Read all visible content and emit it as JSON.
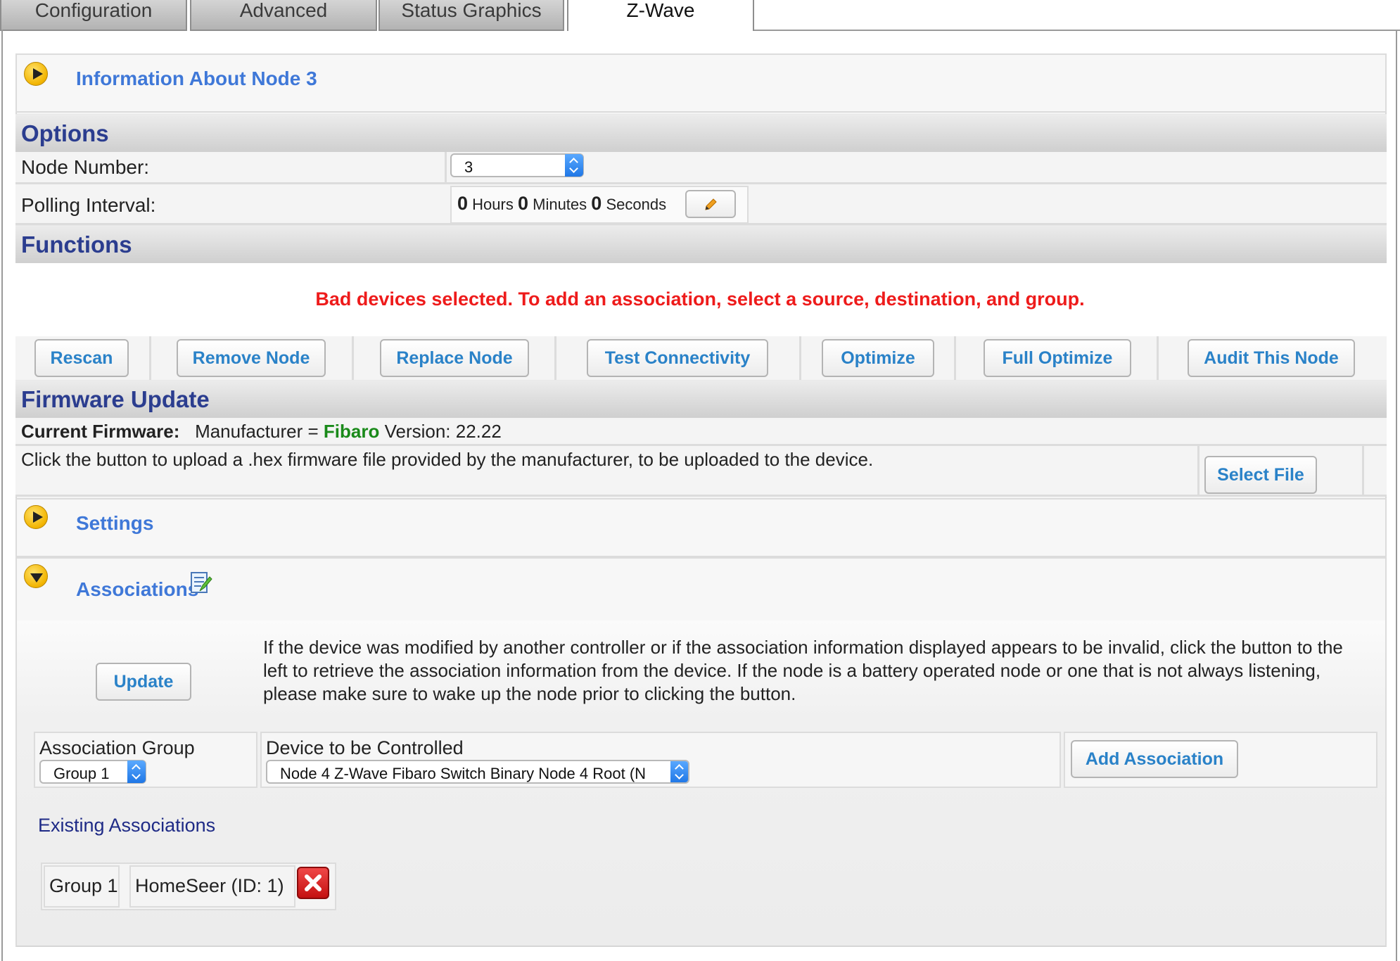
{
  "tabs": [
    {
      "label": "Configuration"
    },
    {
      "label": "Advanced"
    },
    {
      "label": "Status Graphics"
    },
    {
      "label": "Z-Wave"
    }
  ],
  "info_panel": {
    "title": "Information About Node 3"
  },
  "options": {
    "heading": "Options",
    "node_number_label": "Node Number:",
    "node_number_value": "3",
    "polling_label": "Polling Interval:",
    "polling": {
      "hours": "0",
      "hours_unit": "Hours",
      "minutes": "0",
      "minutes_unit": "Minutes",
      "seconds": "0",
      "seconds_unit": "Seconds"
    }
  },
  "functions": {
    "heading": "Functions",
    "error_message": "Bad devices selected. To add an association, select a source, destination, and group.",
    "buttons": [
      "Rescan",
      "Remove Node",
      "Replace Node",
      "Test Connectivity",
      "Optimize",
      "Full Optimize",
      "Audit This Node"
    ]
  },
  "firmware": {
    "heading": "Firmware Update",
    "current_label": "Current Firmware:",
    "manufacturer_prefix": "Manufacturer =",
    "manufacturer": "Fibaro",
    "version": "Version: 22.22",
    "upload_text": "Click the button to upload a .hex firmware file provided by the manufacturer, to be uploaded to the device.",
    "select_file": "Select File"
  },
  "settings_panel": {
    "title": "Settings"
  },
  "associations": {
    "title": "Associations",
    "update_button": "Update",
    "help_text": "If the device was modified by another controller or if the association information displayed appears to be invalid, click the button to the left to retrieve the association information from the device. If the node is a battery operated node or one that is not always listening, please make sure to wake up the node prior to clicking the button.",
    "group_label": "Association Group",
    "group_value": "Group 1",
    "device_label": "Device to be Controlled",
    "device_value": "Node 4 Z-Wave Fibaro Switch Binary Node 4 Root (N",
    "add_button": "Add Association",
    "existing_heading": "Existing Associations",
    "existing": [
      {
        "group": "Group 1",
        "target": "HomeSeer (ID: 1)"
      }
    ]
  },
  "colors": {
    "link_blue": "#3f78d8",
    "heading_navy": "#2b3d8f",
    "error_red": "#ee1b1b",
    "manufacturer_green": "#1a8a1a",
    "button_text": "#2a82c8"
  },
  "icons": [
    "expand-arrow-icon",
    "collapse-arrow-icon",
    "edit-pencil-icon",
    "notepad-icon",
    "delete-x-icon"
  ]
}
